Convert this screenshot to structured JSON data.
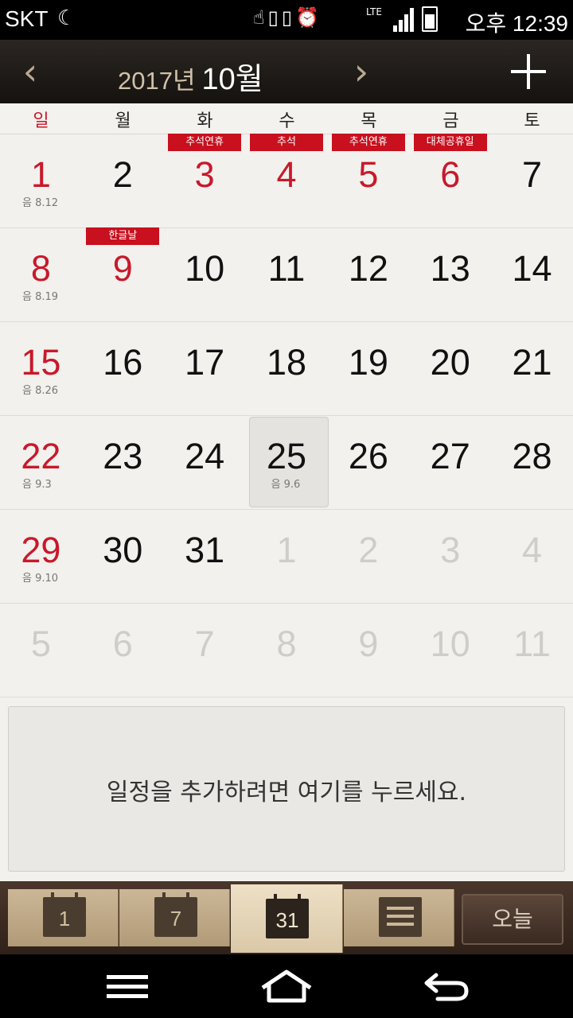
{
  "status": {
    "carrier": "SKT",
    "moon_icon": "☾",
    "time": "오후 12:39",
    "lte": "LTE"
  },
  "header": {
    "year": "2017년",
    "month": "10월",
    "prev_glyph": "‹",
    "next_glyph": "›"
  },
  "weekdays": [
    "일",
    "월",
    "화",
    "수",
    "목",
    "금",
    "토"
  ],
  "weeks": [
    [
      {
        "d": "1",
        "red": true,
        "lunar": "음 8.12"
      },
      {
        "d": "2"
      },
      {
        "d": "3",
        "red": true,
        "badge": "추석연휴"
      },
      {
        "d": "4",
        "red": true,
        "badge": "추석"
      },
      {
        "d": "5",
        "red": true,
        "badge": "추석연휴"
      },
      {
        "d": "6",
        "red": true,
        "badge": "대체공휴일"
      },
      {
        "d": "7"
      }
    ],
    [
      {
        "d": "8",
        "red": true,
        "lunar": "음 8.19"
      },
      {
        "d": "9",
        "red": true,
        "badge": "한글날"
      },
      {
        "d": "10"
      },
      {
        "d": "11"
      },
      {
        "d": "12"
      },
      {
        "d": "13"
      },
      {
        "d": "14"
      }
    ],
    [
      {
        "d": "15",
        "red": true,
        "lunar": "음 8.26"
      },
      {
        "d": "16"
      },
      {
        "d": "17"
      },
      {
        "d": "18"
      },
      {
        "d": "19"
      },
      {
        "d": "20"
      },
      {
        "d": "21"
      }
    ],
    [
      {
        "d": "22",
        "red": true,
        "lunar": "음 9.3"
      },
      {
        "d": "23"
      },
      {
        "d": "24"
      },
      {
        "d": "25",
        "today": true,
        "lunar": "음 9.6"
      },
      {
        "d": "26"
      },
      {
        "d": "27"
      },
      {
        "d": "28"
      }
    ],
    [
      {
        "d": "29",
        "red": true,
        "lunar": "음 9.10"
      },
      {
        "d": "30"
      },
      {
        "d": "31"
      },
      {
        "d": "1",
        "dim": true
      },
      {
        "d": "2",
        "dim": true
      },
      {
        "d": "3",
        "dim": true
      },
      {
        "d": "4",
        "dim": true
      }
    ],
    [
      {
        "d": "5",
        "dim": true
      },
      {
        "d": "6",
        "dim": true
      },
      {
        "d": "7",
        "dim": true
      },
      {
        "d": "8",
        "dim": true
      },
      {
        "d": "9",
        "dim": true
      },
      {
        "d": "10",
        "dim": true
      },
      {
        "d": "11",
        "dim": true
      }
    ]
  ],
  "event_prompt": "일정을 추가하려면 여기를 누르세요.",
  "tabs": {
    "day_label": "1",
    "week_label": "7",
    "month_label": "31",
    "today_label": "오늘"
  },
  "colors": {
    "holiday_red": "#c8192b",
    "badge_red": "#c8101e"
  }
}
